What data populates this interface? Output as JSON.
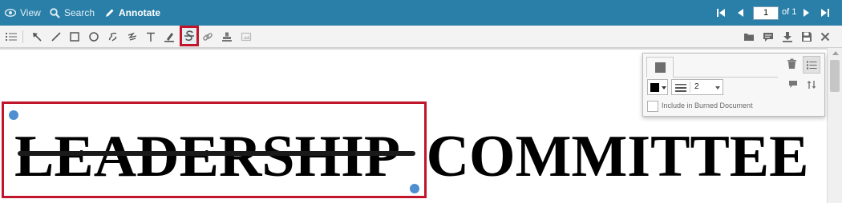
{
  "topbar": {
    "tabs": [
      {
        "label": "View",
        "icon": "eye-icon"
      },
      {
        "label": "Search",
        "icon": "search-icon"
      },
      {
        "label": "Annotate",
        "icon": "pencil-icon"
      }
    ],
    "active_tab": "Annotate",
    "pager": {
      "page_value": "1",
      "page_count_label": "of 1"
    }
  },
  "toolbar": {
    "tools": [
      "list-icon",
      "select-arrow-icon",
      "line-icon",
      "rectangle-icon",
      "ellipse-icon",
      "freehand-icon",
      "polyline-icon",
      "text-icon",
      "highlight-icon",
      "strikethrough-icon",
      "link-icon",
      "stamp-icon",
      "image-icon"
    ],
    "selected_tool": "strikethrough-icon",
    "right_tools": [
      "folder-icon",
      "comment-icon",
      "download-icon",
      "save-icon",
      "close-icon"
    ]
  },
  "document": {
    "heading_words": [
      "LEADERSHIP",
      "COMMITTEE"
    ],
    "struck_word": "LEADERSHIP"
  },
  "properties_panel": {
    "line_color": "#000000",
    "line_width": "2",
    "checkbox_label": "Include in Burned Document",
    "checkbox_checked": false
  },
  "colors": {
    "topbar_bg": "#2a7fa8",
    "selection_red": "#c0152a",
    "handle_blue": "#4f8fd0"
  }
}
